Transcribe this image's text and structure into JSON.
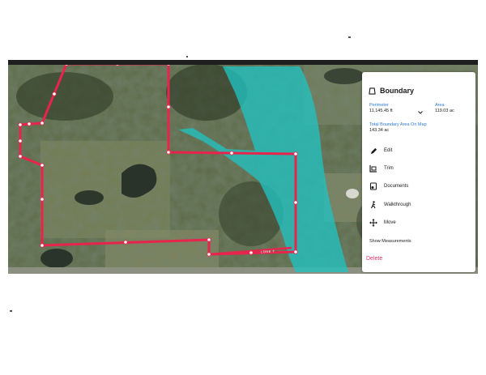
{
  "panel": {
    "title": "Boundary",
    "perimeter_label": "Perimeter",
    "perimeter_value": "11,145.45 ft",
    "area_label": "Area",
    "area_value": "119.03 ac",
    "total_label": "Total Boundary Area On Map",
    "total_value": "143.34 ac",
    "actions": [
      {
        "label": "Edit",
        "icon": "pencil-icon"
      },
      {
        "label": "Trim",
        "icon": "trim-icon"
      },
      {
        "label": "Documents",
        "icon": "documents-icon"
      },
      {
        "label": "Walkthrough",
        "icon": "walk-icon"
      },
      {
        "label": "Move",
        "icon": "move-arrows-icon"
      }
    ],
    "show_measurements": "Show Measurements",
    "delete": "Delete"
  },
  "map": {
    "road_label": "LONE T",
    "boundary_color": "#e8244c",
    "overlay_color": "#21c2c0"
  }
}
